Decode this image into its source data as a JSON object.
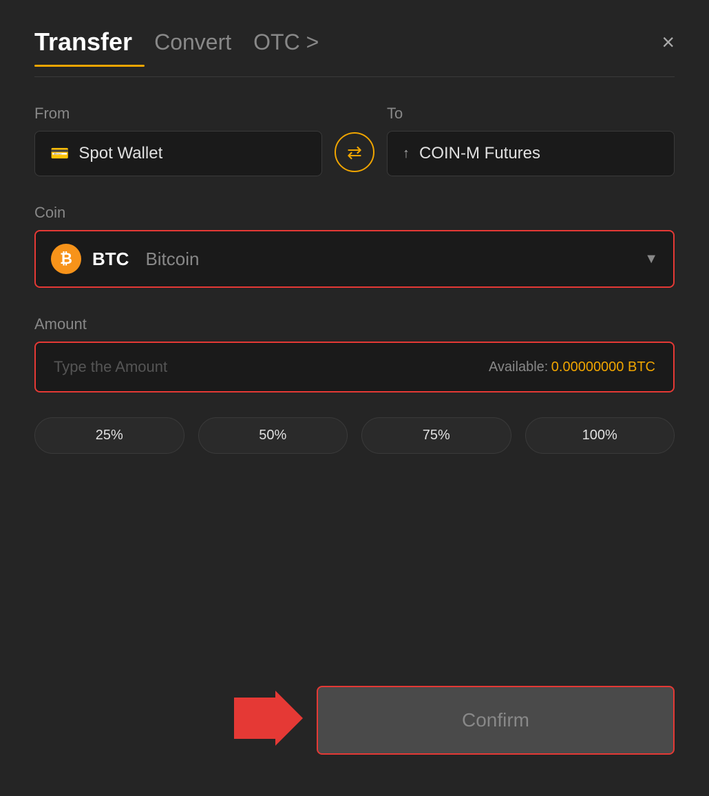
{
  "header": {
    "active_tab": "Transfer",
    "tabs": [
      "Transfer",
      "Convert",
      "OTC >"
    ],
    "close_label": "×"
  },
  "from": {
    "label": "From",
    "wallet_icon": "💳",
    "wallet_name": "Spot Wallet"
  },
  "swap": {
    "icon": "⇄"
  },
  "to": {
    "label": "To",
    "wallet_icon": "↑",
    "wallet_name": "COIN-M Futures"
  },
  "coin": {
    "label": "Coin",
    "symbol": "BTC",
    "full_name": "Bitcoin",
    "icon_letter": "₿"
  },
  "amount": {
    "label": "Amount",
    "placeholder": "Type the Amount",
    "available_label": "Available:",
    "available_value": "0.00000000 BTC"
  },
  "percent_buttons": [
    "25%",
    "50%",
    "75%",
    "100%"
  ],
  "confirm": {
    "label": "Confirm"
  }
}
